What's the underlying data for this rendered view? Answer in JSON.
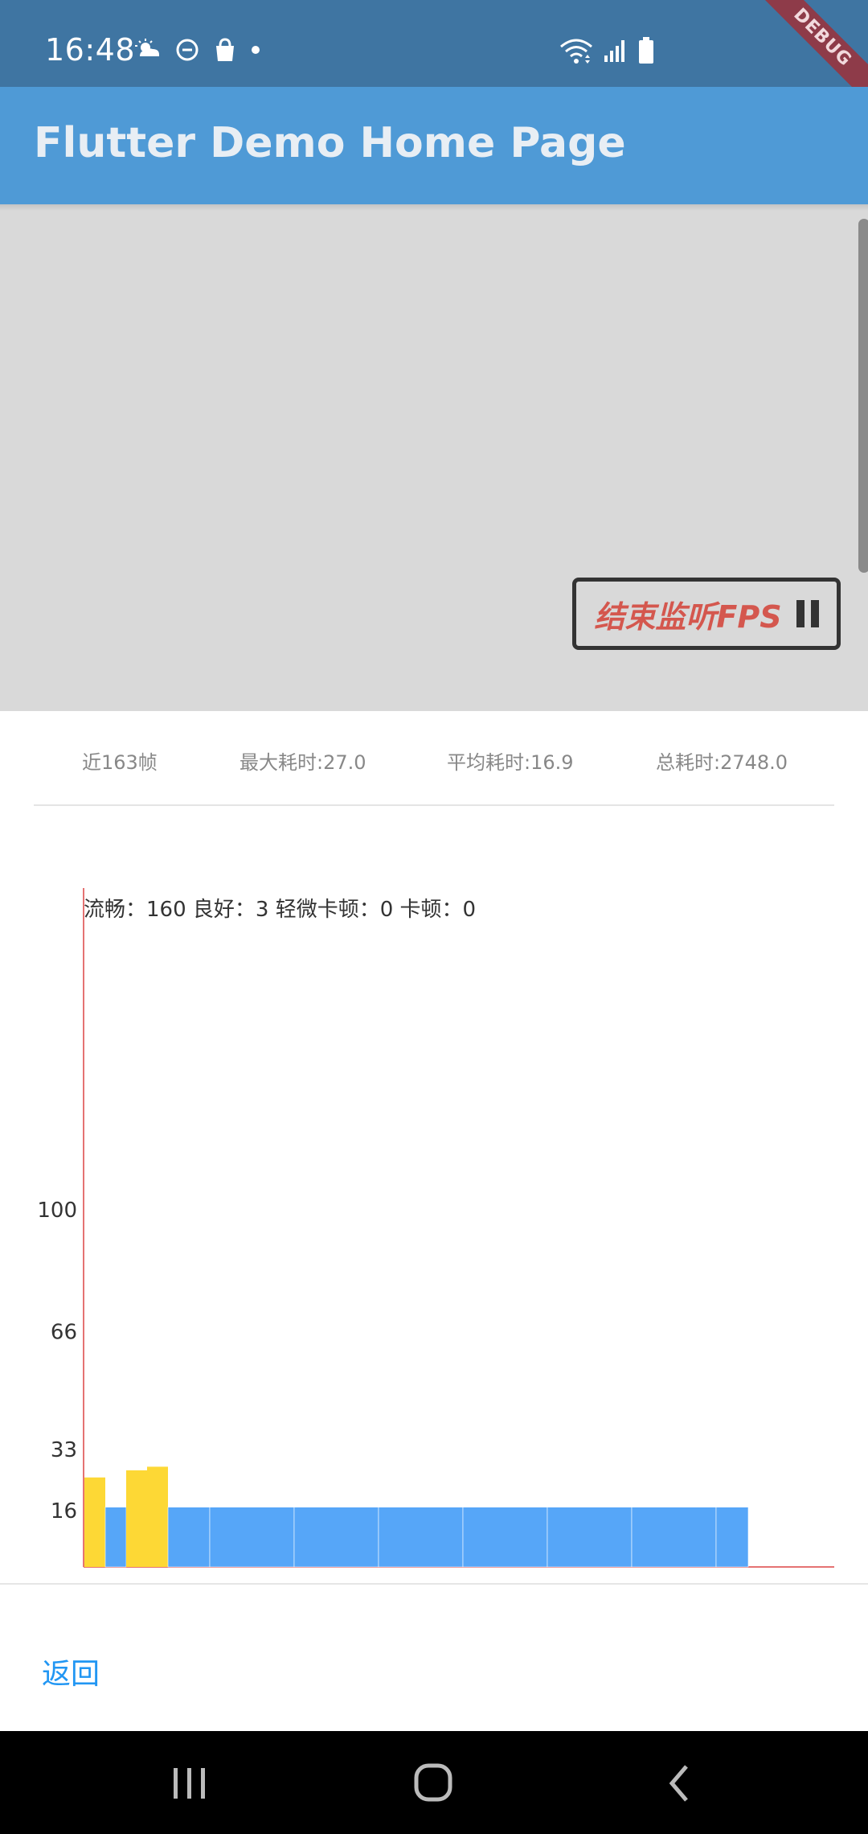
{
  "status_bar": {
    "time": "16:48",
    "left_icons": [
      "weather-sun-cloud-icon",
      "do-not-disturb-icon",
      "shopping-bag-icon",
      "dot-icon"
    ],
    "right_icons": [
      "wifi-icon",
      "signal-icon",
      "battery-icon"
    ]
  },
  "debug_banner": "DEBUG",
  "app_bar": {
    "title": "Flutter Demo Home Page"
  },
  "fps_button": {
    "label": "结束监听FPS",
    "icon": "pause-icon"
  },
  "stats": {
    "frames": "近163帧",
    "max": "最大耗时:27.0",
    "avg": "平均耗时:16.9",
    "total": "总耗时:2748.0"
  },
  "chart_data": {
    "type": "bar",
    "title": "",
    "summary": "流畅：160 良好：3 轻微卡顿：0 卡顿：0",
    "y_ticks": [
      "100",
      "66",
      "33",
      "16"
    ],
    "ylim": [
      0,
      125
    ],
    "series": [
      {
        "name": "良好",
        "color": "#fdd835",
        "values": [
          25,
          27,
          28
        ]
      },
      {
        "name": "流畅",
        "color": "#56a6f8",
        "values": [
          16.7,
          16.7,
          16.7,
          16.7,
          16.7,
          16.7,
          16.7,
          16.7,
          16.7
        ]
      }
    ],
    "axis_color": "#e57373"
  },
  "back_link": "返回",
  "nav_bar": {
    "buttons": [
      "recent-apps-icon",
      "home-icon",
      "back-icon"
    ]
  }
}
